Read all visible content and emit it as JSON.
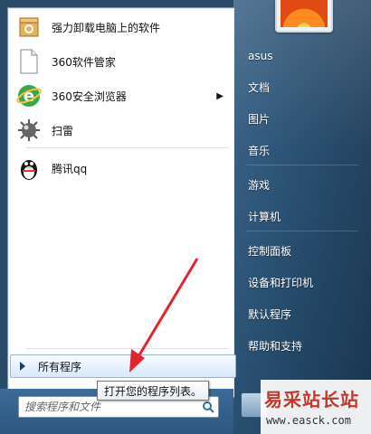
{
  "left_programs": [
    {
      "label": "强力卸载电脑上的软件",
      "icon": "uninstall-box-icon"
    },
    {
      "label": "360软件管家",
      "icon": "blank-document-icon"
    },
    {
      "label": "360安全浏览器",
      "icon": "360-browser-icon",
      "submenu": true
    },
    {
      "label": "扫雷",
      "icon": "minesweeper-icon"
    },
    {
      "label": "腾讯qq",
      "icon": "qq-penguin-icon"
    }
  ],
  "all_programs_label": "所有程序",
  "tooltip_text": "打开您的程序列表。",
  "search_placeholder": "搜索程序和文件",
  "right_items": [
    "asus",
    "文档",
    "图片",
    "音乐",
    "游戏",
    "计算机",
    "控制面板",
    "设备和打印机",
    "默认程序",
    "帮助和支持"
  ],
  "watermark": {
    "logo_text": "易采站长站",
    "url": "www.easck.com"
  },
  "colors": {
    "annotation_arrow": "#e0262a",
    "right_pane": "#254d70"
  }
}
